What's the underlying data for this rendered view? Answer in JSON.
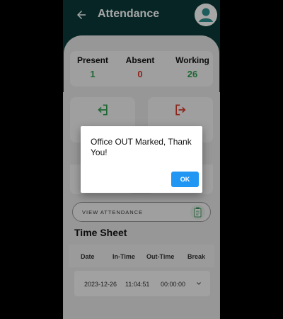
{
  "app_bar": {
    "title": "Attendance",
    "back_icon": "arrow-left-icon",
    "avatar_icon": "account-circle-icon",
    "color": "#0B3A3A"
  },
  "stats": [
    {
      "label": "Present",
      "value": "1",
      "color": "#2E9E4F"
    },
    {
      "label": "Absent",
      "value": "0",
      "color": "#D93A2B"
    },
    {
      "label": "Working",
      "value": "26",
      "color": "#2E9E4F"
    }
  ],
  "mark_buttons": [
    {
      "icon": "login-icon",
      "color": "#2E9E4F"
    },
    {
      "icon": "logout-icon",
      "color": "#D93A2B"
    }
  ],
  "view_attendance": {
    "label": "VIEW ATTENDANCE",
    "icon": "clipboard-icon"
  },
  "time_sheet": {
    "title": "Time Sheet",
    "columns": [
      "Date",
      "In-Time",
      "Out-Time",
      "Break"
    ],
    "rows": [
      {
        "date": "2023-12-26",
        "in_time": "11:04:51",
        "out_time": "00:00:00"
      }
    ]
  },
  "dialog": {
    "message": "Office OUT Marked, Thank You!",
    "ok_label": "OK",
    "ok_color": "#2196F3"
  }
}
